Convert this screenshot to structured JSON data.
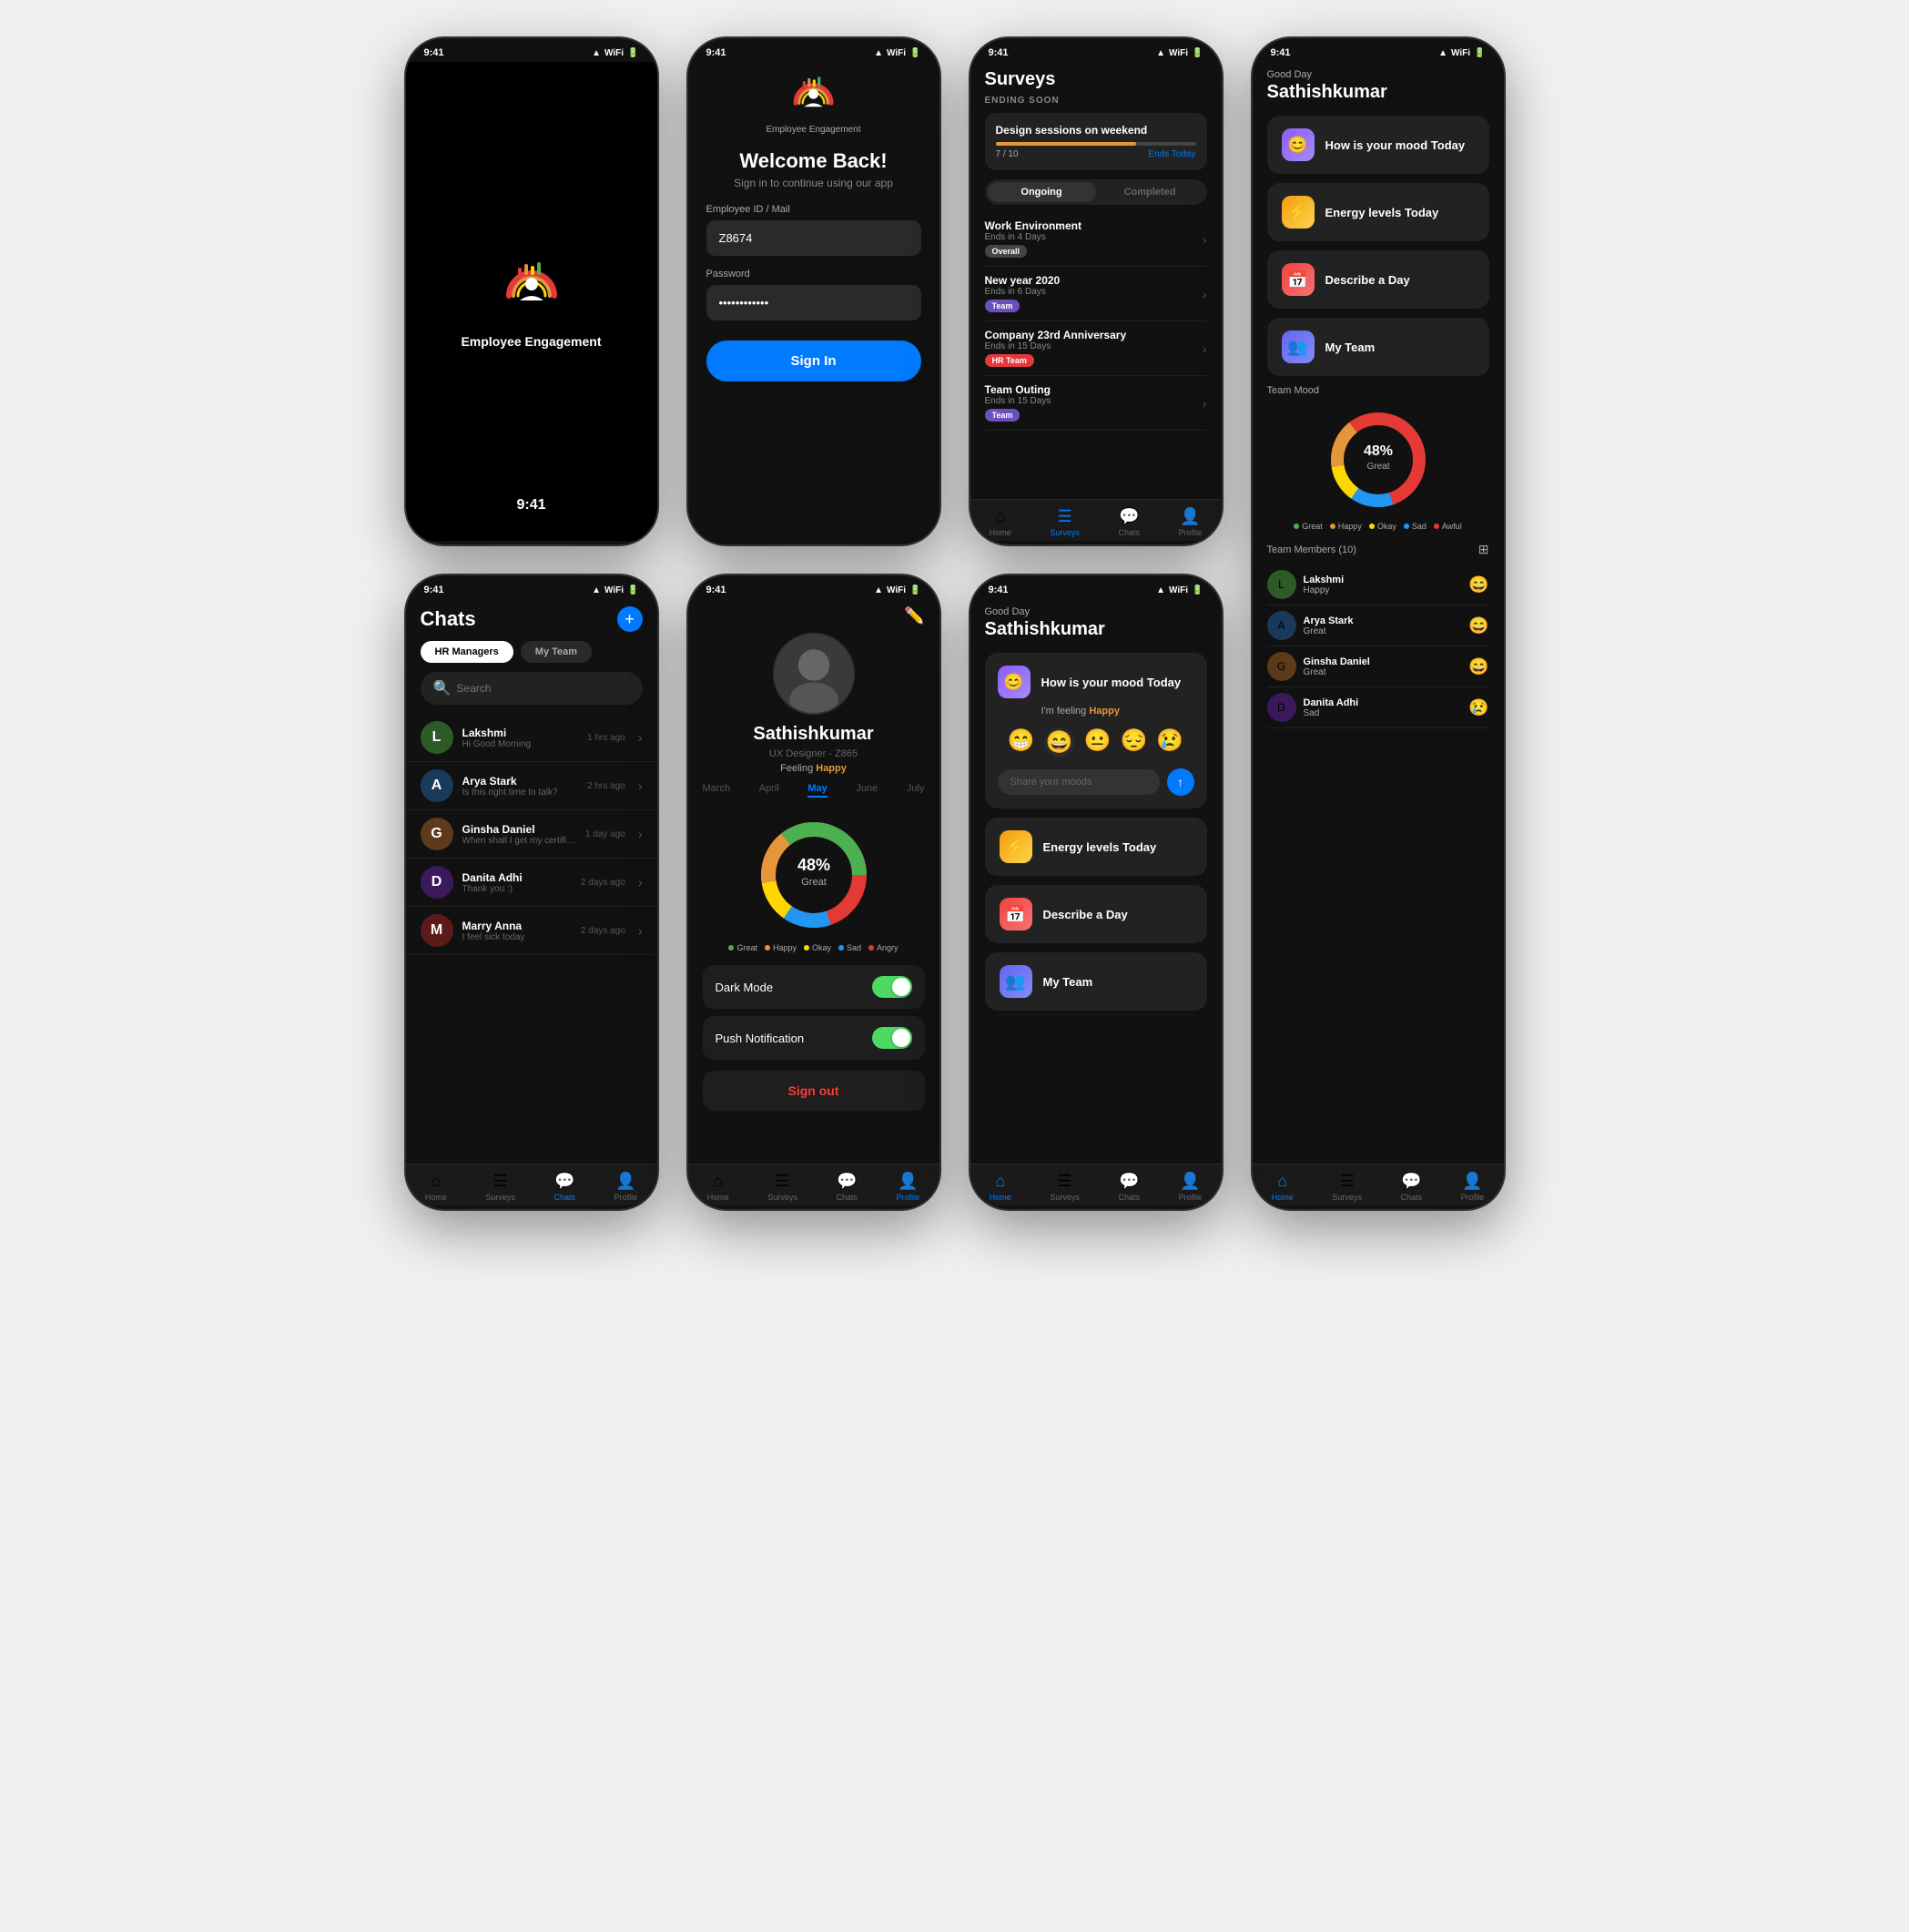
{
  "app": {
    "name": "Employee Engagement",
    "time": "9:41"
  },
  "screen1": {
    "time": "9:41"
  },
  "screen2": {
    "title": "Welcome Back!",
    "subtitle": "Sign in to continue using our app",
    "field1_label": "Employee ID / Mail",
    "field1_value": "Z8674",
    "field2_label": "Password",
    "field2_value": "••••••••••••",
    "signin_label": "Sign In"
  },
  "screen3": {
    "title": "Surveys",
    "ending_soon": "ENDING SOON",
    "featured_title": "Design sessions on weekend",
    "progress": "7 / 10",
    "tab_ongoing": "Ongoing",
    "tab_completed": "Completed",
    "surveys": [
      {
        "title": "Work Environment",
        "ends": "Ends in 4 Days",
        "tag": "Overall",
        "tag_type": "overall"
      },
      {
        "title": "New year 2020",
        "ends": "Ends in 6 Days",
        "tag": "Team",
        "tag_type": "team"
      },
      {
        "title": "Company 23rd Anniversary",
        "ends": "Ends in 15 Days",
        "tag": "HR Team",
        "tag_type": "hr"
      },
      {
        "title": "Team Outing",
        "ends": "Ends in 15 Days",
        "tag": "Team",
        "tag_type": "team"
      }
    ],
    "nav": [
      "Home",
      "Surveys",
      "Chats",
      "Profile"
    ]
  },
  "screen4": {
    "greeting": "Good Day",
    "username": "Sathishkumar",
    "menu_items": [
      {
        "id": "mood",
        "label": "How is your mood Today",
        "icon": "😊",
        "icon_class": "icon-mood"
      },
      {
        "id": "energy",
        "label": "Energy levels Today",
        "icon": "⚡",
        "icon_class": "icon-energy"
      },
      {
        "id": "describe",
        "label": "Describe a Day",
        "icon": "📅",
        "icon_class": "icon-describe"
      },
      {
        "id": "myteam",
        "label": "My Team",
        "icon": "👥",
        "icon_class": "icon-team"
      }
    ],
    "team_mood_label": "Team Mood",
    "donut_percent": "48%",
    "donut_label": "Great",
    "legend": [
      {
        "label": "Great",
        "color": "#4CAF50"
      },
      {
        "label": "Happy",
        "color": "#E5963A"
      },
      {
        "label": "Okay",
        "color": "#FFD700"
      },
      {
        "label": "Sad",
        "color": "#2196F3"
      },
      {
        "label": "Awful",
        "color": "#E53935"
      }
    ],
    "team_members_label": "Team Members (10)",
    "members": [
      {
        "name": "Lakshmi",
        "mood": "Happy",
        "emoji": "😄"
      },
      {
        "name": "Arya Stark",
        "mood": "Great",
        "emoji": "😄"
      },
      {
        "name": "Ginsha Daniel",
        "mood": "Great",
        "emoji": "😄"
      },
      {
        "name": "Danita Adhi",
        "mood": "Sad",
        "emoji": "😢"
      }
    ]
  },
  "screen5": {
    "title": "Chats",
    "tab1": "HR Managers",
    "tab2": "My Team",
    "search_placeholder": "Search",
    "chats": [
      {
        "name": "Lakshmi",
        "preview": "Hi Good Morning",
        "time": "1 hrs ago"
      },
      {
        "name": "Arya Stark",
        "preview": "Is this right time to talk?",
        "time": "2 hrs ago"
      },
      {
        "name": "Ginsha Daniel",
        "preview": "When shall I get my certificates?",
        "time": "1 day ago"
      },
      {
        "name": "Danita Adhi",
        "preview": "Thank you :)",
        "time": "2 days ago"
      },
      {
        "name": "Marry Anna",
        "preview": "I feel sick today",
        "time": "2 days ago"
      }
    ]
  },
  "screen6": {
    "name": "Sathishkumar",
    "role": "UX Designer - Z865",
    "feeling_prefix": "Feeling ",
    "feeling": "Happy",
    "months": [
      "March",
      "April",
      "May",
      "June",
      "July"
    ],
    "active_month": "May",
    "donut_percent": "48%",
    "donut_label": "Great",
    "legend": [
      {
        "label": "Great",
        "color": "#4CAF50"
      },
      {
        "label": "Happy",
        "color": "#E5963A"
      },
      {
        "label": "Okay",
        "color": "#FFD700"
      },
      {
        "label": "Sad",
        "color": "#2196F3"
      },
      {
        "label": "Angry",
        "color": "#E53935"
      }
    ],
    "settings": [
      {
        "label": "Dark Mode",
        "on": true
      },
      {
        "label": "Push Notification",
        "on": true
      }
    ],
    "signout_label": "Sign out"
  },
  "screen7": {
    "greeting": "Good Day",
    "username": "Sathishkumar",
    "menu_items": [
      {
        "id": "mood",
        "label": "How is your mood Today",
        "icon": "😊",
        "icon_class": "icon-mood"
      },
      {
        "id": "energy",
        "label": "Energy levels Today",
        "icon": "⚡",
        "icon_class": "icon-energy"
      },
      {
        "id": "describe",
        "label": "Describe a Day",
        "icon": "📅",
        "icon_class": "icon-describe"
      },
      {
        "id": "myteam",
        "label": "My Team",
        "icon": "👥",
        "icon_class": "icon-team"
      }
    ],
    "mood_section": {
      "feeling_prefix": "I'm feeling ",
      "feeling": "Happy",
      "emojis": [
        "😁",
        "😄",
        "😐",
        "😔",
        "😢"
      ],
      "placeholder": "Share your moods"
    }
  }
}
